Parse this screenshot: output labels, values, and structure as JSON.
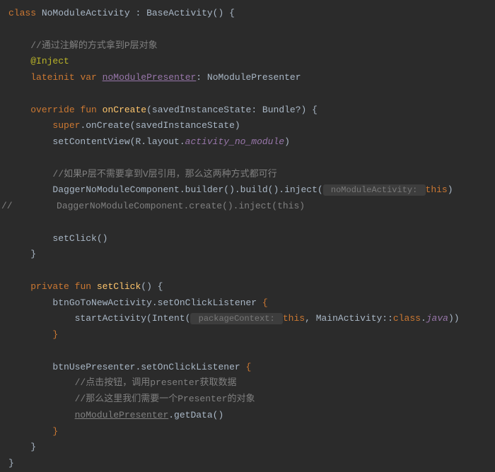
{
  "code": {
    "class_kw": "class",
    "class_name": "NoModuleActivity",
    "extends": ": BaseActivity() {",
    "comment1": "//通过注解的方式拿到P层对象",
    "inject_anno": "@Inject",
    "lateinit": "lateinit",
    "var_kw": "var",
    "presenter_var": "noModulePresenter",
    "presenter_type": ": NoModulePresenter",
    "override_kw": "override",
    "fun_kw": "fun",
    "onCreate_name": "onCreate",
    "onCreate_params": "(savedInstanceState: Bundle?) {",
    "super_kw": "super",
    "super_call": ".onCreate(savedInstanceState)",
    "setContentView": "setContentView(R.layout.",
    "activity_no_module": "activity_no_module",
    "close_paren": ")",
    "comment2": "//如果P层不需要拿到V层引用，那么这两种方式都可行",
    "dagger_build": "DaggerNoModuleComponent.builder().build().inject(",
    "hint_activity": " noModuleActivity: ",
    "this_kw": "this",
    "comment_slash": "//",
    "dagger_create": "DaggerNoModuleComponent.create().inject(this)",
    "setClick_call": "setClick()",
    "close_brace": "}",
    "private_kw": "private",
    "setClick_name": "setClick",
    "setClick_params": "() {",
    "btnGoNew": "btnGoToNewActivity.setOnClickListener ",
    "open_brace": "{",
    "startActivity": "startActivity(Intent(",
    "hint_ctx": " packageContext: ",
    "comma_main": ", MainActivity::",
    "class_kw2": "class",
    "dot_java": ".",
    "java_prop": "java",
    "close2": "))",
    "btnUse": "btnUsePresenter.setOnClickListener ",
    "comment3": "//点击按钮，调用presenter获取数据",
    "comment4": "//那么这里我们需要一个Presenter的对象",
    "presenter_call": "noModulePresenter",
    "getData": ".getData()"
  }
}
